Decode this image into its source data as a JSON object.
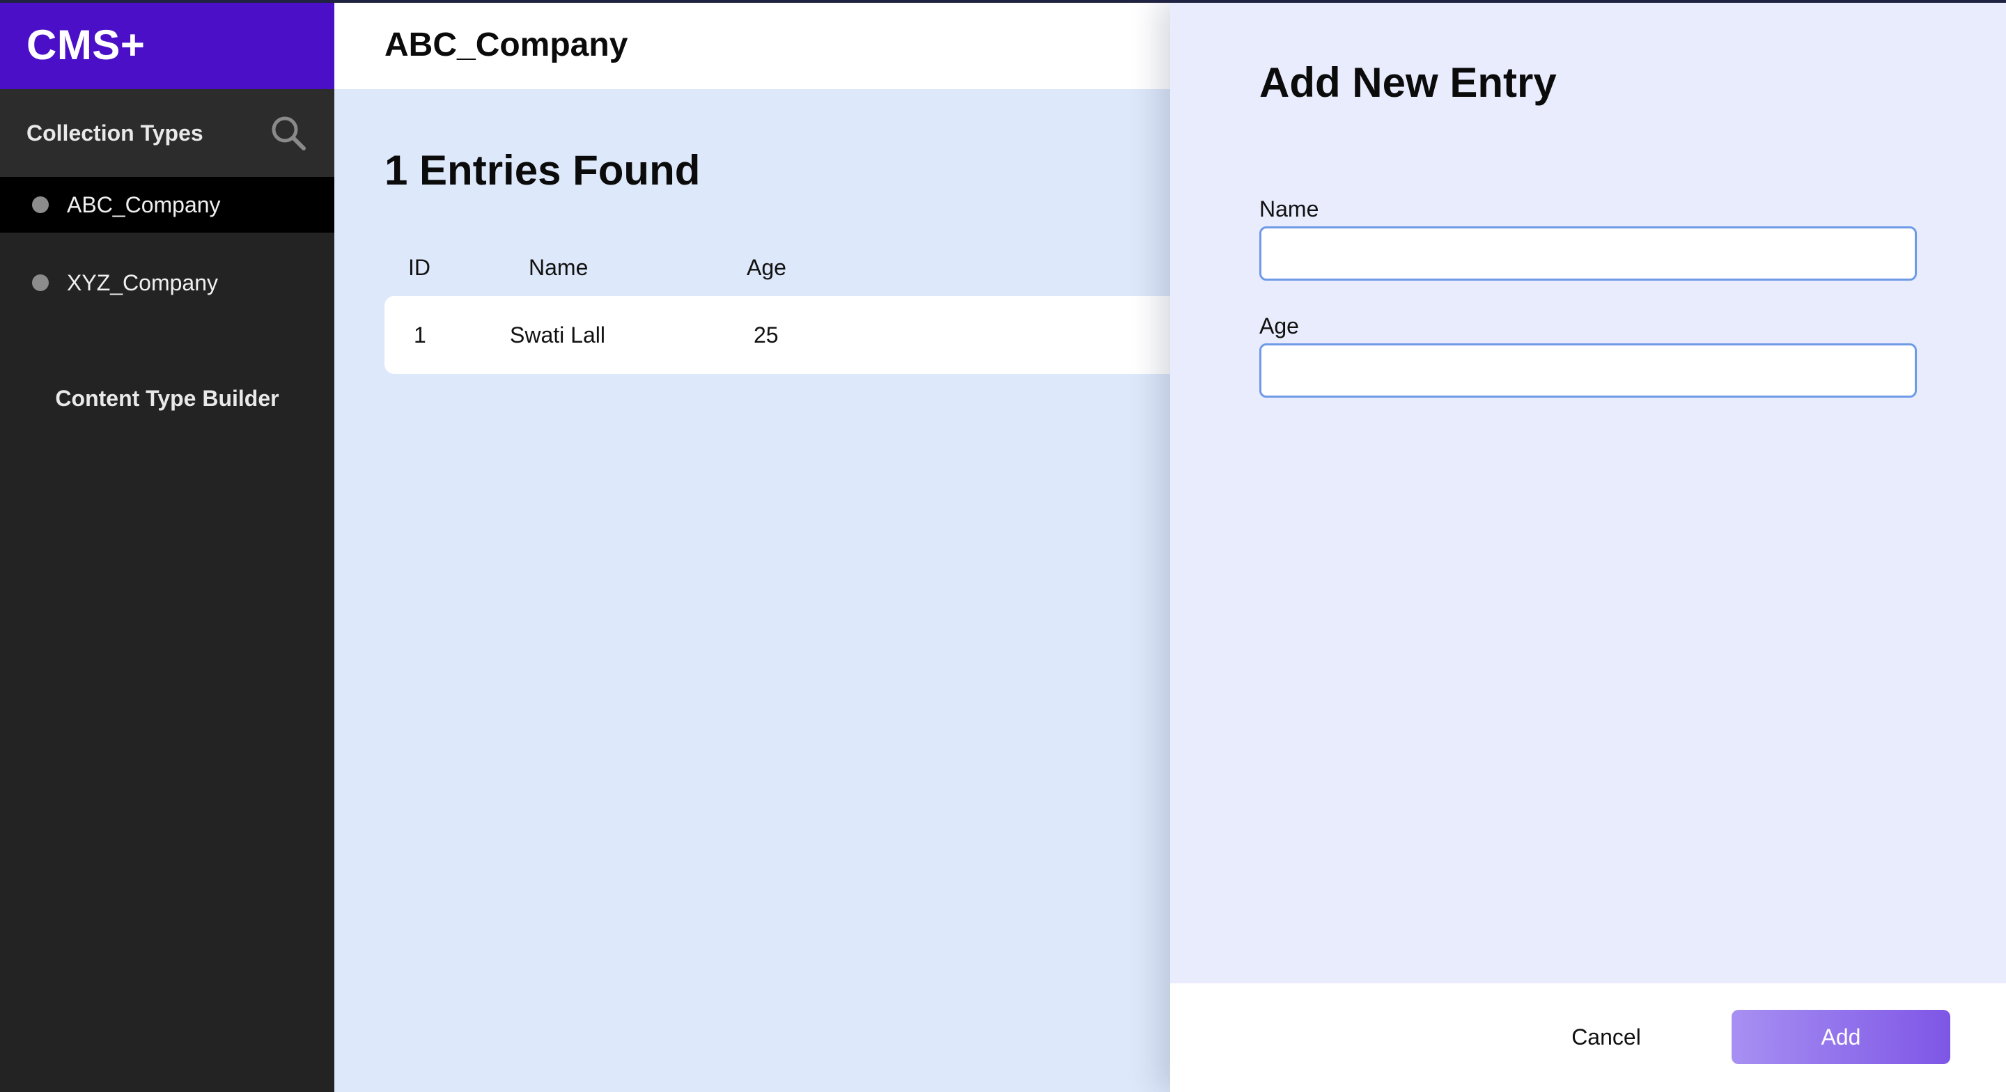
{
  "app": {
    "brand": "CMS+"
  },
  "sidebar": {
    "section_title": "Collection Types",
    "search_icon": "search-icon",
    "items": [
      {
        "label": "ABC_Company",
        "active": true
      },
      {
        "label": "XYZ_Company",
        "active": false
      }
    ],
    "builder_label": "Content Type Builder"
  },
  "main": {
    "header_title": "ABC_Company",
    "entries_title": "1 Entries Found",
    "table": {
      "columns": [
        "ID",
        "Name",
        "Age"
      ],
      "rows": [
        [
          "1",
          "Swati Lall",
          "25"
        ]
      ]
    }
  },
  "panel": {
    "title": "Add New Entry",
    "fields": [
      {
        "label": "Name",
        "value": "",
        "placeholder": ""
      },
      {
        "label": "Age",
        "value": "",
        "placeholder": ""
      }
    ],
    "cancel_label": "Cancel",
    "add_label": "Add"
  },
  "colors": {
    "brand": "#4a0fc7",
    "sidebar": "#232323",
    "main_bg": "#dde8fa",
    "panel_bg": "#e9ecfc",
    "input_border": "#6e9ae6",
    "add_button": "#7e56e6"
  }
}
